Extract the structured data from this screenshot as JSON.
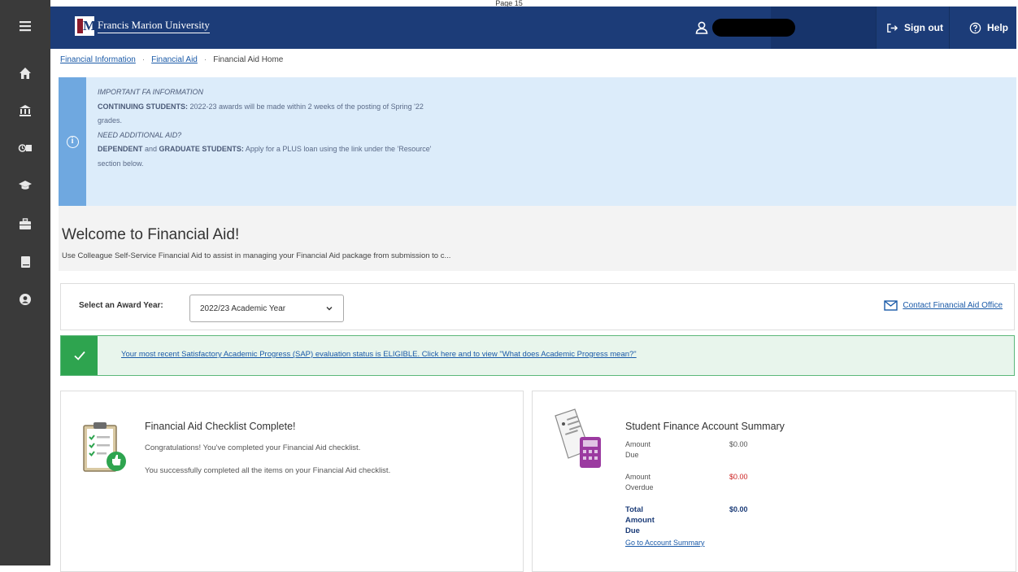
{
  "page_caption": "Page 15",
  "header": {
    "university_name": "Francis Marion University",
    "sign_out_label": "Sign out",
    "help_label": "Help"
  },
  "breadcrumb": [
    "Financial Information",
    "Financial Aid",
    "Financial Aid Home"
  ],
  "info_alert": {
    "heading": "IMPORTANT FA INFORMATION",
    "line1_em": "CONTINUING STUDENTS:",
    "line1_rest": " 2022-23 awards will be made within 2 weeks of the posting of Spring '22",
    "line1_cont": "grades.",
    "heading2": "NEED ADDITIONAL AID?",
    "line2_em": "DEPENDENT",
    "line2_mid": " and ",
    "line2_em2": "GRADUATE STUDENTS:",
    "line2_rest": " Apply for a PLUS loan using the link under the 'Resource'",
    "line2_cont": "section below."
  },
  "welcome": {
    "title": "Welcome to Financial Aid!",
    "subtitle": "Use Colleague Self-Service Financial Aid to assist in managing your Financial Aid package from submission to c..."
  },
  "award_year": {
    "label": "Select an Award Year:",
    "selected": "2022/23 Academic Year"
  },
  "contact_link": "Contact Financial Aid Office",
  "sap_message": "Your most recent Satisfactory Academic Progress (SAP) evaluation status is ELIGIBLE. Click here and to view \"What does Academic Progress mean?\"",
  "checklist": {
    "title": "Financial Aid Checklist Complete!",
    "p1": "Congratulations! You've completed your Financial Aid checklist.",
    "p2": "You successfully completed all the items on your Financial Aid checklist."
  },
  "finance": {
    "title": "Student Finance Account Summary",
    "rows": [
      {
        "label1": "Amount",
        "label2": "Due",
        "amount": "$0.00",
        "color": "#555555"
      },
      {
        "label1": "Amount",
        "label2": "Overdue",
        "amount": "$0.00",
        "color": "#cc2222"
      },
      {
        "label1": "Total",
        "label2": "Amount",
        "label3": "Due",
        "amount": "$0.00",
        "color": "#1c3c78"
      }
    ],
    "link": "Go to Account Summary"
  }
}
